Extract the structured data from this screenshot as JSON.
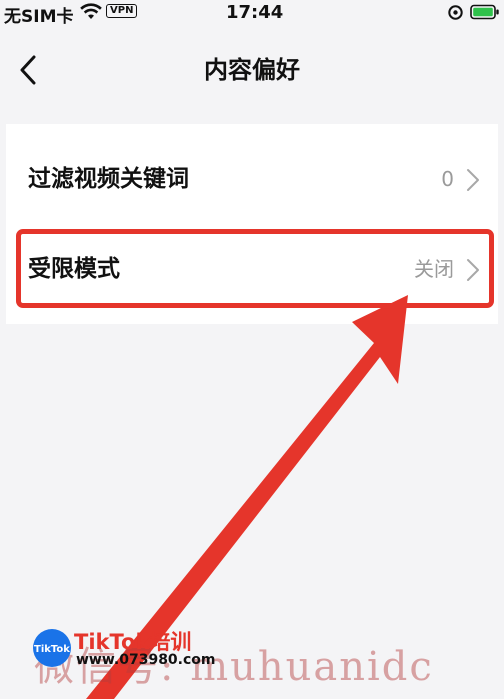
{
  "status_bar": {
    "carrier": "无SIM卡",
    "vpn": "VPN",
    "time": "17:44"
  },
  "nav": {
    "title": "内容偏好"
  },
  "settings": {
    "keywords": {
      "label": "过滤视频关键词",
      "value": "0"
    },
    "restricted_mode": {
      "label": "受限模式",
      "value": "关闭"
    }
  },
  "colors": {
    "highlight": "#e5352b",
    "page_bg": "#f4f4f6",
    "card_bg": "#ffffff",
    "secondary_text": "#9a9a9a"
  },
  "icons": {
    "back": "chevron-left-icon",
    "row_arrow": "chevron-right-icon",
    "wifi": "wifi-icon",
    "location": "location-icon",
    "battery": "battery-icon"
  },
  "watermark": {
    "text": "微信号: muhuanidc",
    "brand": "TikTok培训",
    "logo_text": "TikTok",
    "url": "www.073980.com"
  }
}
